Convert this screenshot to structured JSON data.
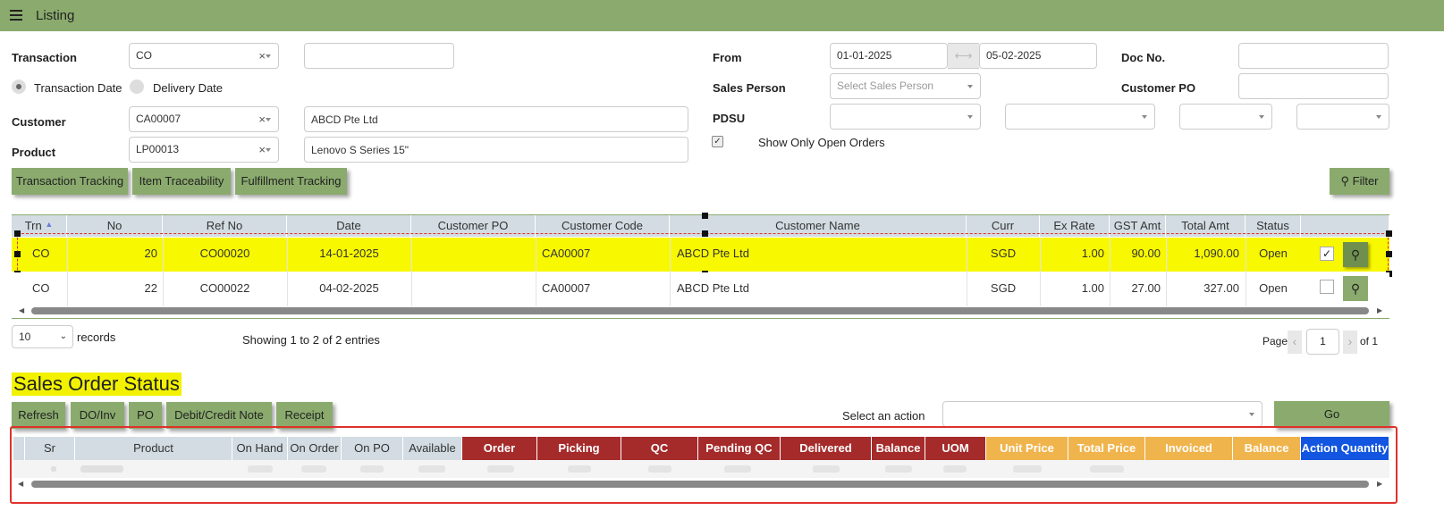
{
  "header": {
    "title": "Listing"
  },
  "filters": {
    "transaction_label": "Transaction",
    "transaction_value": "CO",
    "transaction_date_label": "Transaction Date",
    "delivery_date_label": "Delivery Date",
    "customer_label": "Customer",
    "customer_code": "CA00007",
    "customer_name": "ABCD Pte Ltd",
    "product_label": "Product",
    "product_code": "LP00013",
    "product_name": "Lenovo S Series 15\"",
    "from_label": "From",
    "from_date": "01-01-2025",
    "to_date": "05-02-2025",
    "sales_person_label": "Sales Person",
    "sales_person_placeholder": "Select Sales Person",
    "pdsu_label": "PDSU",
    "show_open_label": "Show Only Open Orders",
    "doc_no_label": "Doc No.",
    "customer_po_label": "Customer PO"
  },
  "buttons": {
    "transaction_tracking": "Transaction Tracking",
    "item_traceability": "Item Traceability",
    "fulfillment_tracking": "Fulfillment Tracking",
    "filter": "Filter"
  },
  "listing": {
    "columns": [
      "Trn",
      "No",
      "Ref No",
      "Date",
      "Customer PO",
      "Customer Code",
      "Customer Name",
      "Curr",
      "Ex Rate",
      "GST Amt",
      "Total Amt",
      "Status"
    ],
    "rows": [
      {
        "trn": "CO",
        "no": "20",
        "ref": "CO00020",
        "date": "14-01-2025",
        "po": "",
        "code": "CA00007",
        "name": "ABCD Pte Ltd",
        "curr": "SGD",
        "rate": "1.00",
        "gst": "90.00",
        "total": "1,090.00",
        "status": "Open",
        "checked": "✓"
      },
      {
        "trn": "CO",
        "no": "22",
        "ref": "CO00022",
        "date": "04-02-2025",
        "po": "",
        "code": "CA00007",
        "name": "ABCD Pte Ltd",
        "curr": "SGD",
        "rate": "1.00",
        "gst": "27.00",
        "total": "327.00",
        "status": "Open",
        "checked": ""
      }
    ]
  },
  "pagination": {
    "page_size": "10",
    "records_label": "records",
    "showing": "Showing 1 to 2 of 2 entries",
    "page_label": "Page",
    "page": "1",
    "of_label": "of 1"
  },
  "sales_order_status": {
    "title": "Sales Order Status",
    "buttons": [
      "Refresh",
      "DO/Inv",
      "PO",
      "Debit/Credit Note",
      "Receipt"
    ],
    "select_action_label": "Select an action",
    "go_label": "Go",
    "columns": [
      "Sr",
      "Product",
      "On Hand",
      "On Order",
      "On PO",
      "Available",
      "Order",
      "Picking",
      "QC",
      "Pending QC",
      "Delivered",
      "Balance",
      "UOM",
      "Unit Price",
      "Total Price",
      "Invoiced",
      "Balance",
      "Action Quantity"
    ]
  },
  "colors": {
    "header_green": "#8aab6d",
    "highlight_yellow": "#f8f800",
    "red_header": "#a52a2a",
    "orange_header": "#f0b44c",
    "blue_header": "#1155e0"
  }
}
